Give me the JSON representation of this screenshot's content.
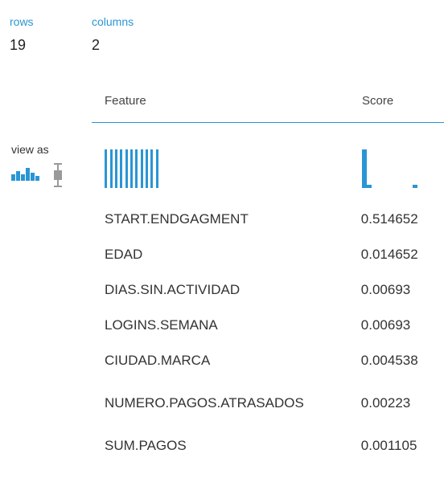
{
  "stats": {
    "rows_label": "rows",
    "rows_value": "19",
    "columns_label": "columns",
    "columns_value": "2"
  },
  "table": {
    "headers": {
      "feature": "Feature",
      "score": "Score"
    },
    "view_as_label": "view as",
    "rows": [
      {
        "feature": "START.ENDGAGMENT",
        "score": "0.514652"
      },
      {
        "feature": "EDAD",
        "score": "0.014652"
      },
      {
        "feature": "DIAS.SIN.ACTIVIDAD",
        "score": "0.00693"
      },
      {
        "feature": "LOGINS.SEMANA",
        "score": "0.00693"
      },
      {
        "feature": "CIUDAD.MARCA",
        "score": "0.004538"
      },
      {
        "feature": "NUMERO.PAGOS.ATRASADOS",
        "score": "0.00223"
      },
      {
        "feature": "SUM.PAGOS",
        "score": "0.001105"
      }
    ]
  },
  "icons": {
    "histogram_view": "histogram-icon",
    "boxplot_view": "boxplot-icon"
  },
  "colors": {
    "accent": "#2a95d5",
    "text": "#333333"
  }
}
